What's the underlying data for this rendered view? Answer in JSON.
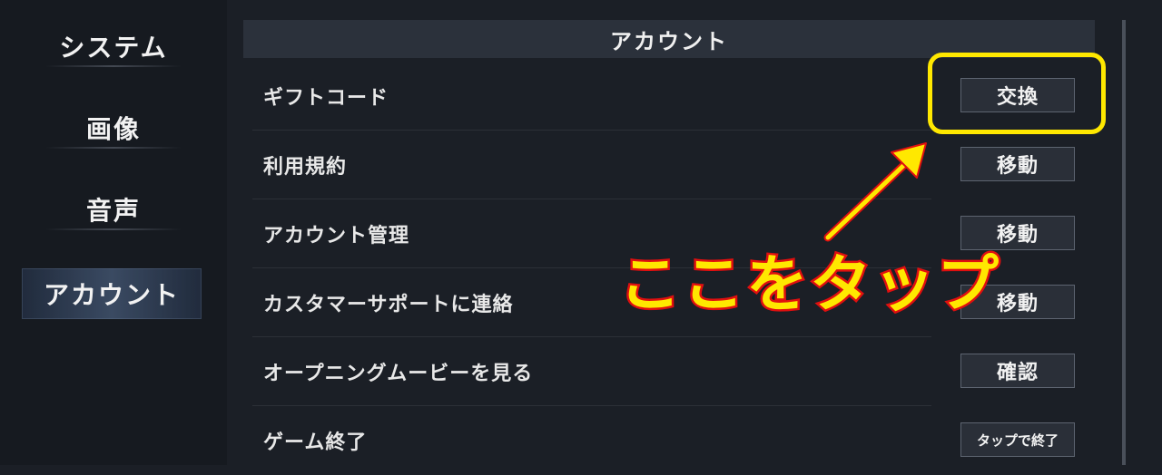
{
  "sidebar": {
    "items": [
      {
        "label": "システム",
        "active": false
      },
      {
        "label": "画像",
        "active": false
      },
      {
        "label": "音声",
        "active": false
      },
      {
        "label": "アカウント",
        "active": true
      }
    ]
  },
  "main": {
    "section_title": "アカウント",
    "rows": [
      {
        "label": "ギフトコード",
        "button": "交換"
      },
      {
        "label": "利用規約",
        "button": "移動"
      },
      {
        "label": "アカウント管理",
        "button": "移動"
      },
      {
        "label": "カスタマーサポートに連絡",
        "button": "移動"
      },
      {
        "label": "オープニングムービーを見る",
        "button": "確認"
      },
      {
        "label": "ゲーム終了",
        "button": "タップで終了"
      }
    ]
  },
  "annotation": {
    "callout_text": "ここをタップ",
    "color": "#ffe800",
    "outline_color": "#e01010"
  }
}
